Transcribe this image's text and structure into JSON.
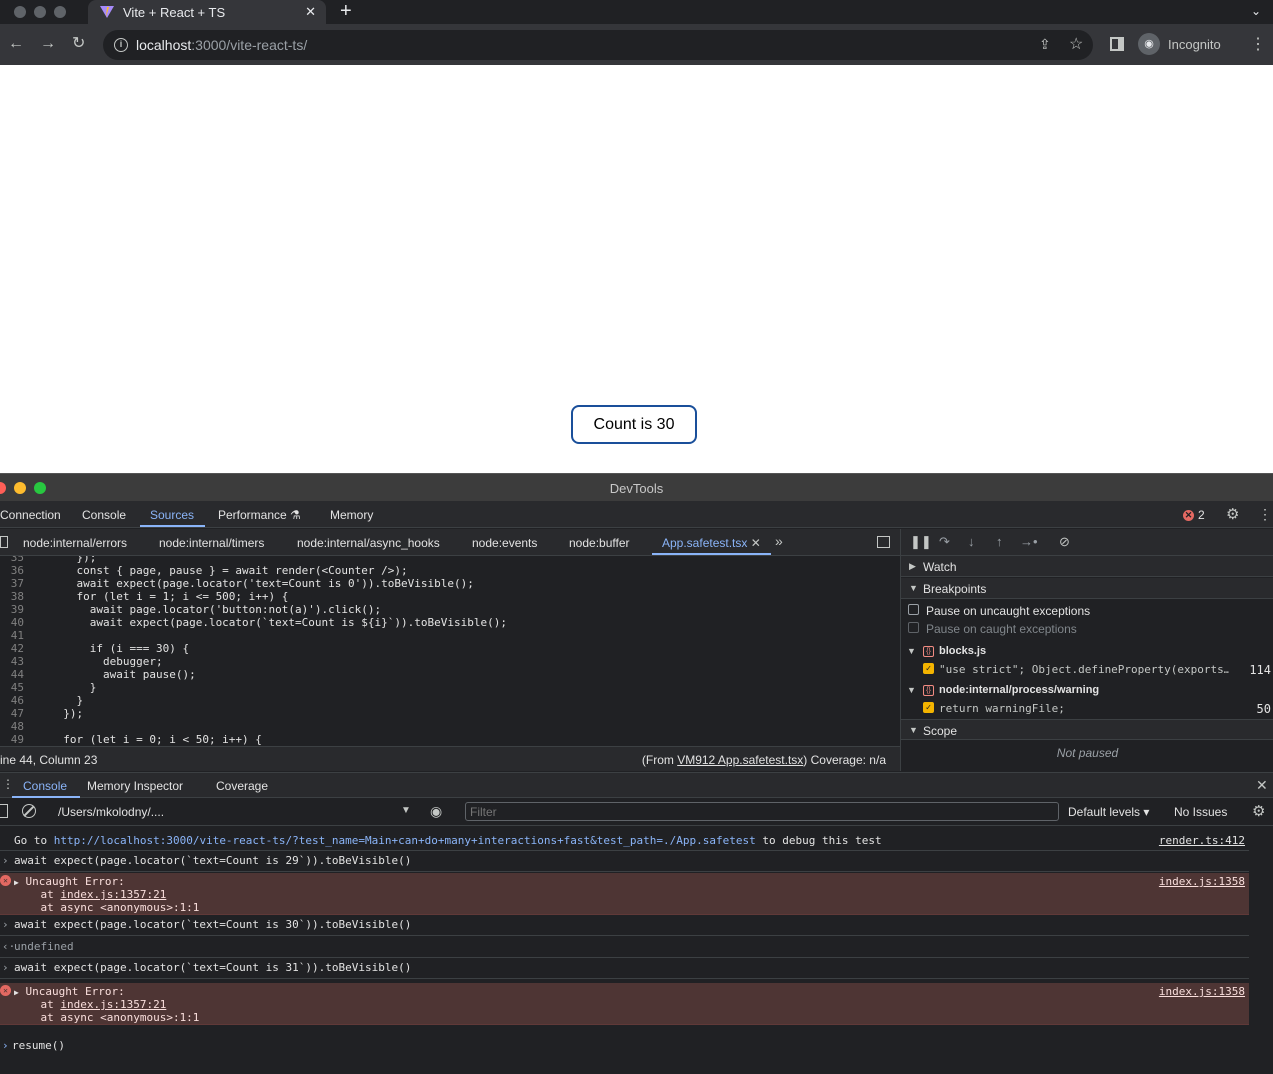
{
  "browser": {
    "tab_title": "Vite + React + TS",
    "new_tab": "+",
    "url_host": "localhost",
    "url_path": ":3000/vite-react-ts/",
    "incognito": "Incognito"
  },
  "page": {
    "count_label": "Count is 30"
  },
  "devtools": {
    "title": "DevTools",
    "tabs": [
      "Connection",
      "Console",
      "Sources",
      "Performance",
      "Memory"
    ],
    "error_count": "2",
    "source_tabs": [
      "node:internal/errors",
      "node:internal/timers",
      "node:internal/async_hooks",
      "node:events",
      "node:buffer",
      "App.safetest.tsx"
    ],
    "code_lines": [
      {
        "n": "35",
        "t": "    });"
      },
      {
        "n": "36",
        "t": "    const { page, pause } = await render(<Counter />);"
      },
      {
        "n": "37",
        "t": "    await expect(page.locator('text=Count is 0')).toBeVisible();"
      },
      {
        "n": "38",
        "t": "    for (let i = 1; i <= 500; i++) {"
      },
      {
        "n": "39",
        "t": "      await page.locator('button:not(a)').click();"
      },
      {
        "n": "40",
        "t": "      await expect(page.locator(`text=Count is ${i}`)).toBeVisible();"
      },
      {
        "n": "41",
        "t": ""
      },
      {
        "n": "42",
        "t": "      if (i === 30) {"
      },
      {
        "n": "43",
        "t": "        debugger;"
      },
      {
        "n": "44",
        "t": "        await pause();"
      },
      {
        "n": "45",
        "t": "      }"
      },
      {
        "n": "46",
        "t": "    }"
      },
      {
        "n": "47",
        "t": "  });"
      },
      {
        "n": "48",
        "t": ""
      },
      {
        "n": "49",
        "t": "  for (let i = 0; i < 50; i++) {"
      }
    ],
    "status_left": "ine 44, Column 23",
    "status_from": "(From ",
    "status_link": "VM912 App.safetest.tsx",
    "status_coverage": ") Coverage: n/a",
    "watch": "Watch",
    "breakpoints": "Breakpoints",
    "pause_uncaught": "Pause on uncaught exceptions",
    "pause_caught": "Pause on caught exceptions",
    "bp_files": [
      {
        "file": "blocks.js",
        "code": "\"use strict\"; Object.defineProperty(exports…",
        "line": "114"
      },
      {
        "file": "node:internal/process/warning",
        "code": "return warningFile;",
        "line": "50"
      }
    ],
    "scope": "Scope",
    "not_paused": "Not paused"
  },
  "drawer": {
    "tabs": [
      "Console",
      "Memory Inspector",
      "Coverage"
    ],
    "context": "/Users/mkolodny/....",
    "filter_placeholder": "Filter",
    "levels": "Default levels ▾",
    "issues": "No Issues"
  },
  "console": {
    "goto_pre": "Go to ",
    "goto_link": "http://localhost:3000/vite-react-ts/?test_name=Main+can+do+many+interactions+fast&test_path=./App.safetest",
    "goto_post": " to debug this test",
    "goto_src": "render.ts:412",
    "cmd1": "await expect(page.locator(`text=Count is 29`)).toBeVisible()",
    "err1_title": "Uncaught Error:",
    "err1_at1_pre": "    at ",
    "err1_at1_link": "index.js:1357:21",
    "err1_at2": "    at async <anonymous>:1:1",
    "err1_src": "index.js:1358",
    "cmd2": "await expect(page.locator(`text=Count is 30`)).toBeVisible()",
    "result2": "undefined",
    "cmd3": "await expect(page.locator(`text=Count is 31`)).toBeVisible()",
    "err2_title": "Uncaught Error:",
    "err2_at1_pre": "    at ",
    "err2_at1_link": "index.js:1357:21",
    "err2_at2": "    at async <anonymous>:1:1",
    "err2_src": "index.js:1358",
    "input": "resume()"
  }
}
